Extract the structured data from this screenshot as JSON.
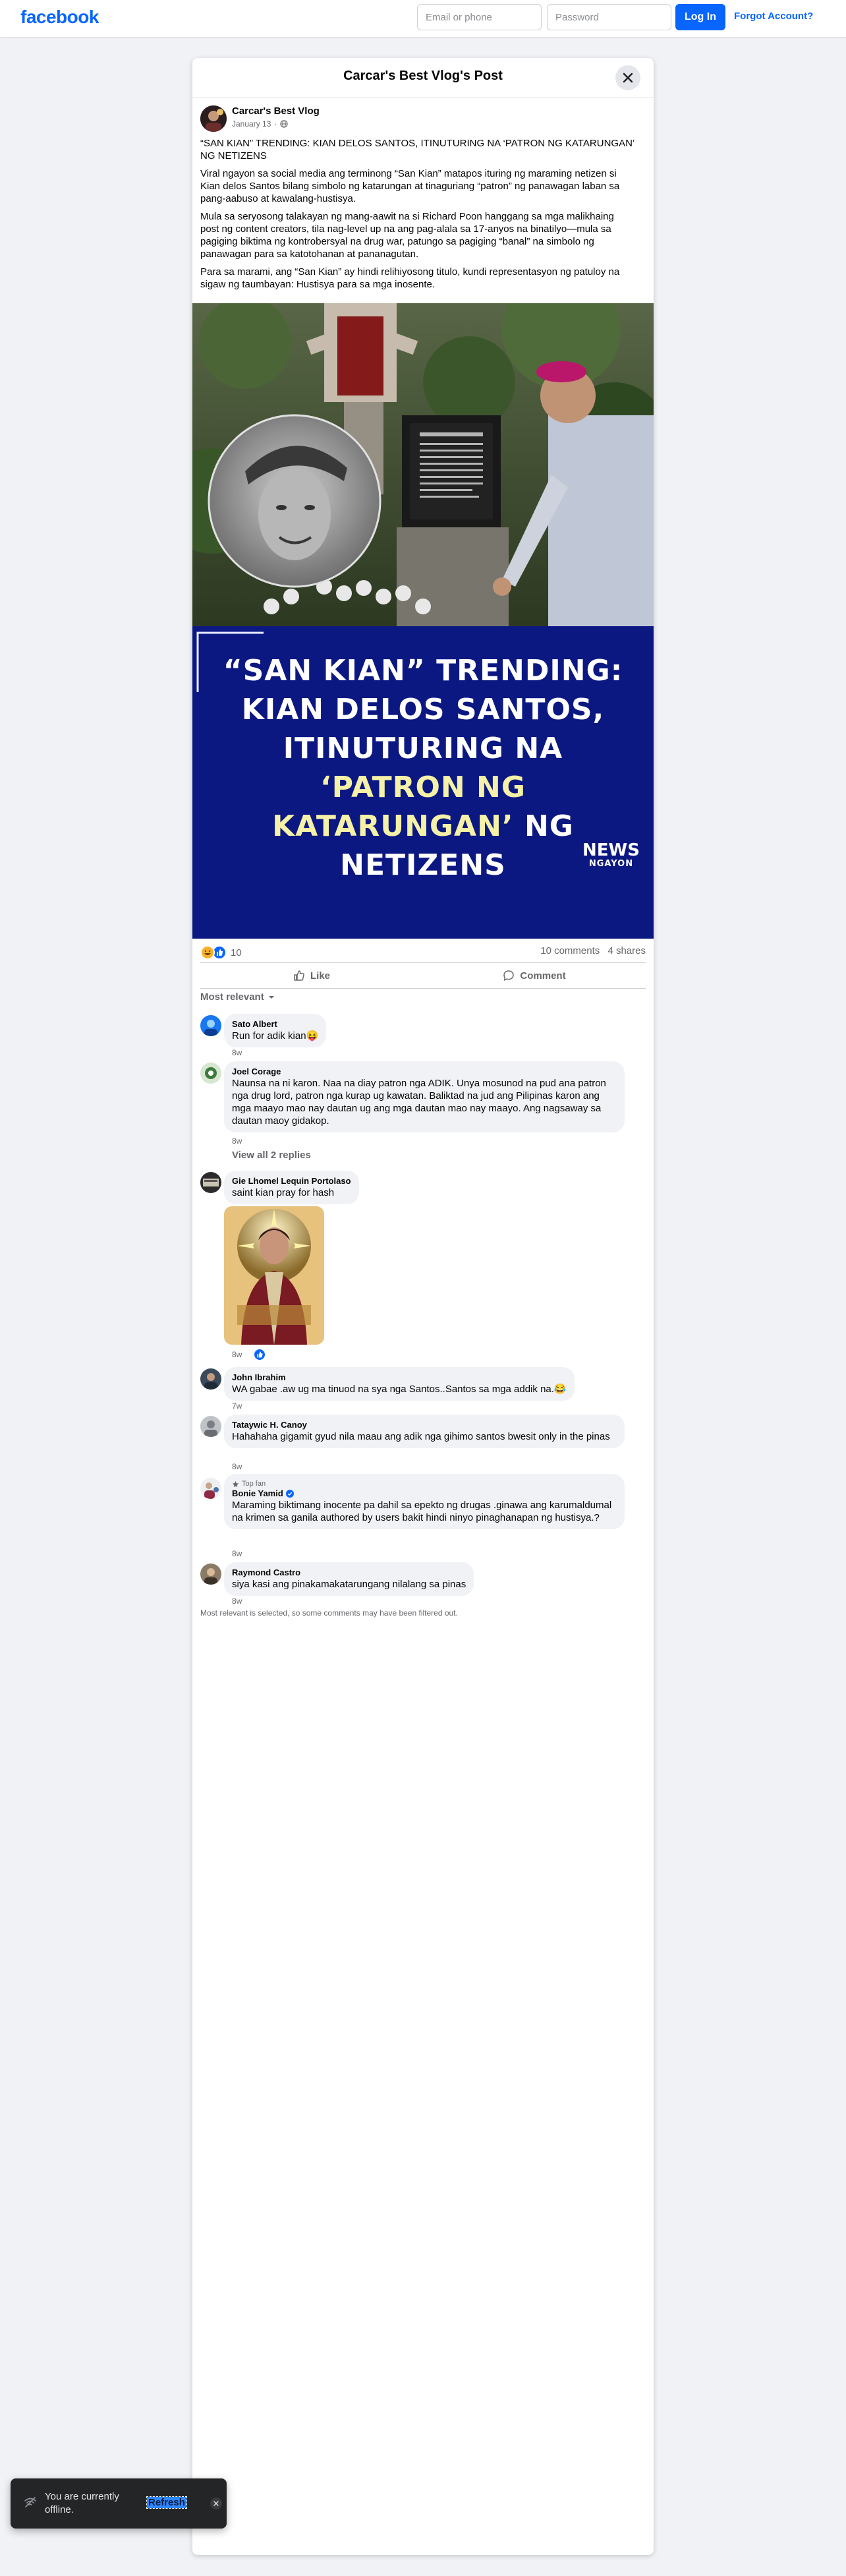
{
  "header": {
    "logo": "facebook",
    "email_placeholder": "Email or phone",
    "password_placeholder": "Password",
    "login_label": "Log In",
    "forgot_label": "Forgot Account?"
  },
  "post": {
    "dialog_title": "Carcar's Best Vlog's Post",
    "author": "Carcar's Best Vlog",
    "date": "January 13",
    "privacy_icon": "globe-icon",
    "paragraphs": [
      "“SAN KIAN” TRENDING: KIAN DELOS SANTOS, ITINUTURING NA ‘PATRON NG KATARUNGAN’ NG NETIZENS",
      "Viral ngayon sa social media ang terminong “San Kian” matapos ituring ng maraming netizen si Kian delos Santos bilang simbolo ng katarungan at tinaguriang “patron” ng panawagan laban sa pang-aabuso at kawalang-hustisya.",
      "Mula sa seryosong talakayan ng mang-aawit na si Richard Poon hanggang sa mga malikhaing post ng content creators, tila nag-level up na ang pag-alala sa 17-anyos na binatilyo—mula sa pagiging biktima ng kontrobersyal na drug war, patungo sa pagiging “banal” na simbolo ng panawagan para sa katotohanan at pananagutan.",
      "Para sa marami, ang “San Kian” ay hindi relihiyosong titulo, kundi representasyon ng patuloy na sigaw ng taumbayan: Hustisya para sa mga inosente."
    ],
    "image": {
      "headline_white_1": "“SAN KIAN” TRENDING: KIAN DELOS SANTOS, ITINUTURING NA ",
      "headline_yellow": "‘PATRON NG KATARUNGAN’",
      "headline_white_2": " NG NETIZENS",
      "brand_top": "NEWS",
      "brand_bottom": "NGAYON",
      "banner_color": "#0c1882",
      "highlight_color": "#f5f1a6"
    },
    "reactions_count": "10",
    "comments_count": "10 comments",
    "shares_count": "4 shares",
    "like_label": "Like",
    "comment_label": "Comment",
    "sort_label": "Most relevant"
  },
  "comments": [
    {
      "name": "Sato Albert",
      "text": "Run for adik kian😝",
      "time": "8w"
    },
    {
      "name": "Joel Corage",
      "text": "Naunsa na ni karon. Naa na diay patron nga ADIK. Unya mosunod na pud ana patron nga drug lord, patron nga kurap ug kawatan. Baliktad na jud ang Pilipinas karon ang mga maayo mao nay dautan ug ang mga dautan mao nay maayo. Ang nagsaway sa dautan maoy gidakop.",
      "time": "8w",
      "replies": "View all 2 replies"
    },
    {
      "name": "Gie Lhomel Lequin Portolaso",
      "text": "saint kian pray for hash",
      "time": "8w",
      "reaction_icon": "like-reaction-icon"
    },
    {
      "name": "John Ibrahim",
      "text": "WA gabae .aw ug ma tinuod na sya nga Santos..Santos sa mga addik na.😂",
      "time": "7w"
    },
    {
      "name": "Tataywic H. Canoy",
      "text": "Hahahaha gigamit gyud nila maau ang adik nga gihimo santos bwesit only in the pinas",
      "time": "8w"
    },
    {
      "name": "Bonie Yamid",
      "badge": "Top fan",
      "text": "Maraming biktimang inocente pa dahil sa epekto ng drugas .ginawa ang karumaldumal na krimen sa ganila authored by users bakit hindi ninyo pinaghanapan ng hustisya.?",
      "time": "8w"
    },
    {
      "name": "Raymond Castro",
      "text": "siya kasi ang pinakamakatarungang nilalang sa pinas",
      "time": "8w"
    }
  ],
  "footer_note": "Most relevant is selected, so some comments may have been filtered out.",
  "toast": {
    "message": "You are currently offline.",
    "refresh_label": "Refresh"
  }
}
